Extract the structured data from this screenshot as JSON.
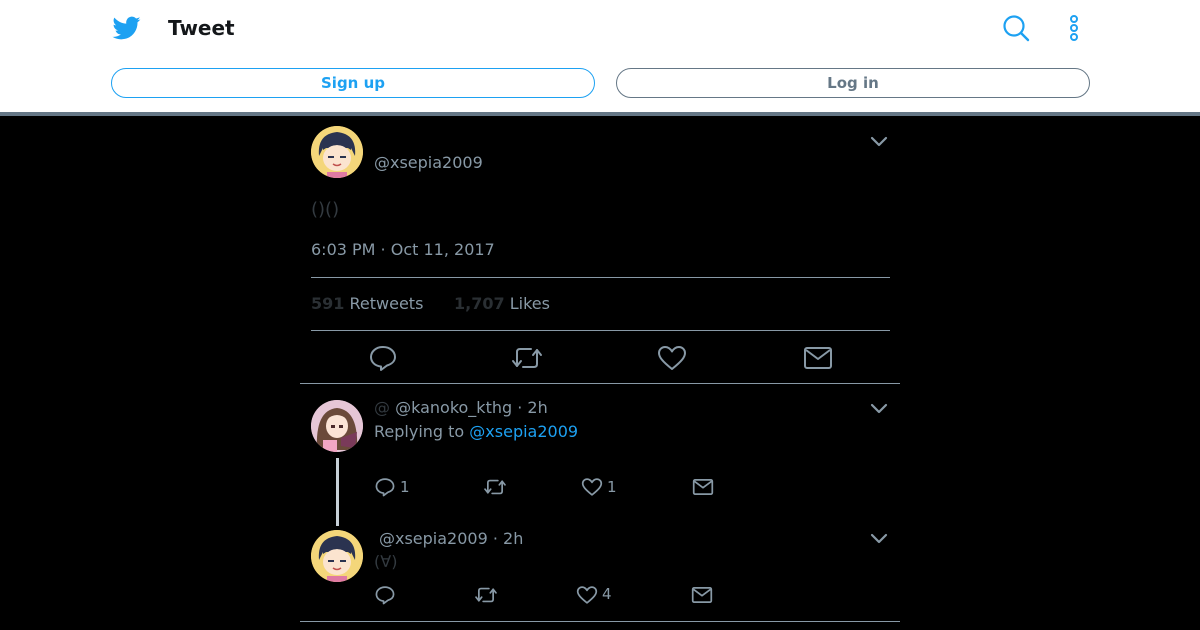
{
  "header": {
    "title": "Tweet",
    "signup_label": "Sign up",
    "login_label": "Log in",
    "accent_color": "#1da1f2",
    "icons": [
      "bird-logo-icon",
      "search-icon",
      "more-vertical-icon"
    ]
  },
  "main_tweet": {
    "handle": "@xsepia2009",
    "text": "()()",
    "timestamp": "6:03 PM · Oct 11, 2017",
    "retweets_count": "591",
    "retweets_label": "Retweets",
    "likes_count": "1,707",
    "likes_label": "Likes",
    "actions": [
      "reply-icon",
      "retweet-icon",
      "like-icon",
      "message-icon"
    ]
  },
  "replies": [
    {
      "at": "@",
      "handle": "@kanoko_kthg",
      "time": "· 2h",
      "replying_to_label": "Replying to",
      "replying_to_handle": "@xsepia2009",
      "reply_count": "1",
      "like_count": "1"
    },
    {
      "handle": "@xsepia2009",
      "time": "· 2h",
      "text": "(∀)",
      "like_count": "4"
    }
  ]
}
